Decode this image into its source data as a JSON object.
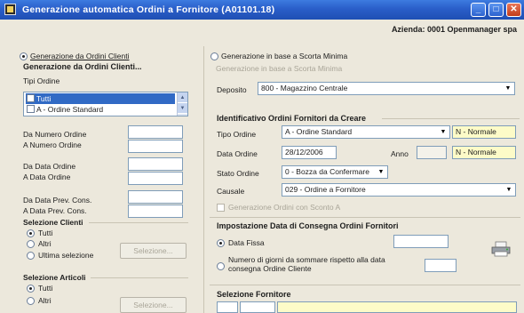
{
  "window": {
    "title": "Generazione automatica Ordini a Fornitore   (A01101.18)"
  },
  "header": {
    "azienda": "Azienda:  0001  Openmanager  spa"
  },
  "mode": {
    "from_orders": "Generazione da Ordini Clienti",
    "from_stock": "Generazione in base a Scorta Minima",
    "stock_group_title": "Generazione in base a Scorta Minima"
  },
  "left": {
    "group_title": "Generazione da Ordini Clienti...",
    "tipi_ordine_label": "Tipi Ordine",
    "tipi_ordine": [
      {
        "label": "Tutti",
        "checked": true,
        "selected": true
      },
      {
        "label": "A - Ordine Standard",
        "checked": false,
        "selected": false
      }
    ],
    "da_numero_label": "Da Numero Ordine",
    "a_numero_label": "A   Numero Ordine",
    "da_data_label": "Da Data Ordine",
    "a_data_label": "A   Data Ordine",
    "da_prev_label": "Da Data Prev. Cons.",
    "a_prev_label": "A   Data Prev. Cons.",
    "clienti_title": "Selezione Clienti",
    "clienti_tutti": "Tutti",
    "clienti_altri": "Altri",
    "clienti_ultima": "Ultima selezione",
    "clienti_button": "Selezione...",
    "articoli_title": "Selezione Articoli",
    "articoli_tutti": "Tutti",
    "articoli_altri": "Altri",
    "articoli_button": "Selezione..."
  },
  "right": {
    "deposito_label": "Deposito",
    "deposito_value": "800 - Magazzino Centrale",
    "id_title": "Identificativo Ordini Fornitori da Creare",
    "tipo_ordine_label": "Tipo Ordine",
    "tipo_ordine_value": "A - Ordine Standard",
    "tipo_ordine_badge": "N - Normale",
    "data_ordine_label": "Data Ordine",
    "data_ordine_value": "28/12/2006",
    "anno_label": "Anno",
    "data_ordine_badge": "N - Normale",
    "stato_label": "Stato Ordine",
    "stato_value": "0 - Bozza da Confermare",
    "causale_label": "Causale",
    "causale_value": "029 - Ordine a Fornitore",
    "genera_label": "Generazione Ordini con Sconto A",
    "consegna_title": "Impostazione Data di Consegna Ordini Fornitori",
    "data_fissa": "Data Fissa",
    "numero_giorni": "Numero di giorni da sommare rispetto alla data consegna Ordine Cliente",
    "fornitore_title": "Selezione Fornitore"
  },
  "icons": {
    "printer": "printer-icon",
    "app": "app-icon"
  },
  "colors": {
    "titlebar": "#2a5ec9",
    "selection": "#316ac5",
    "highlight_field": "#fdfbc8"
  }
}
